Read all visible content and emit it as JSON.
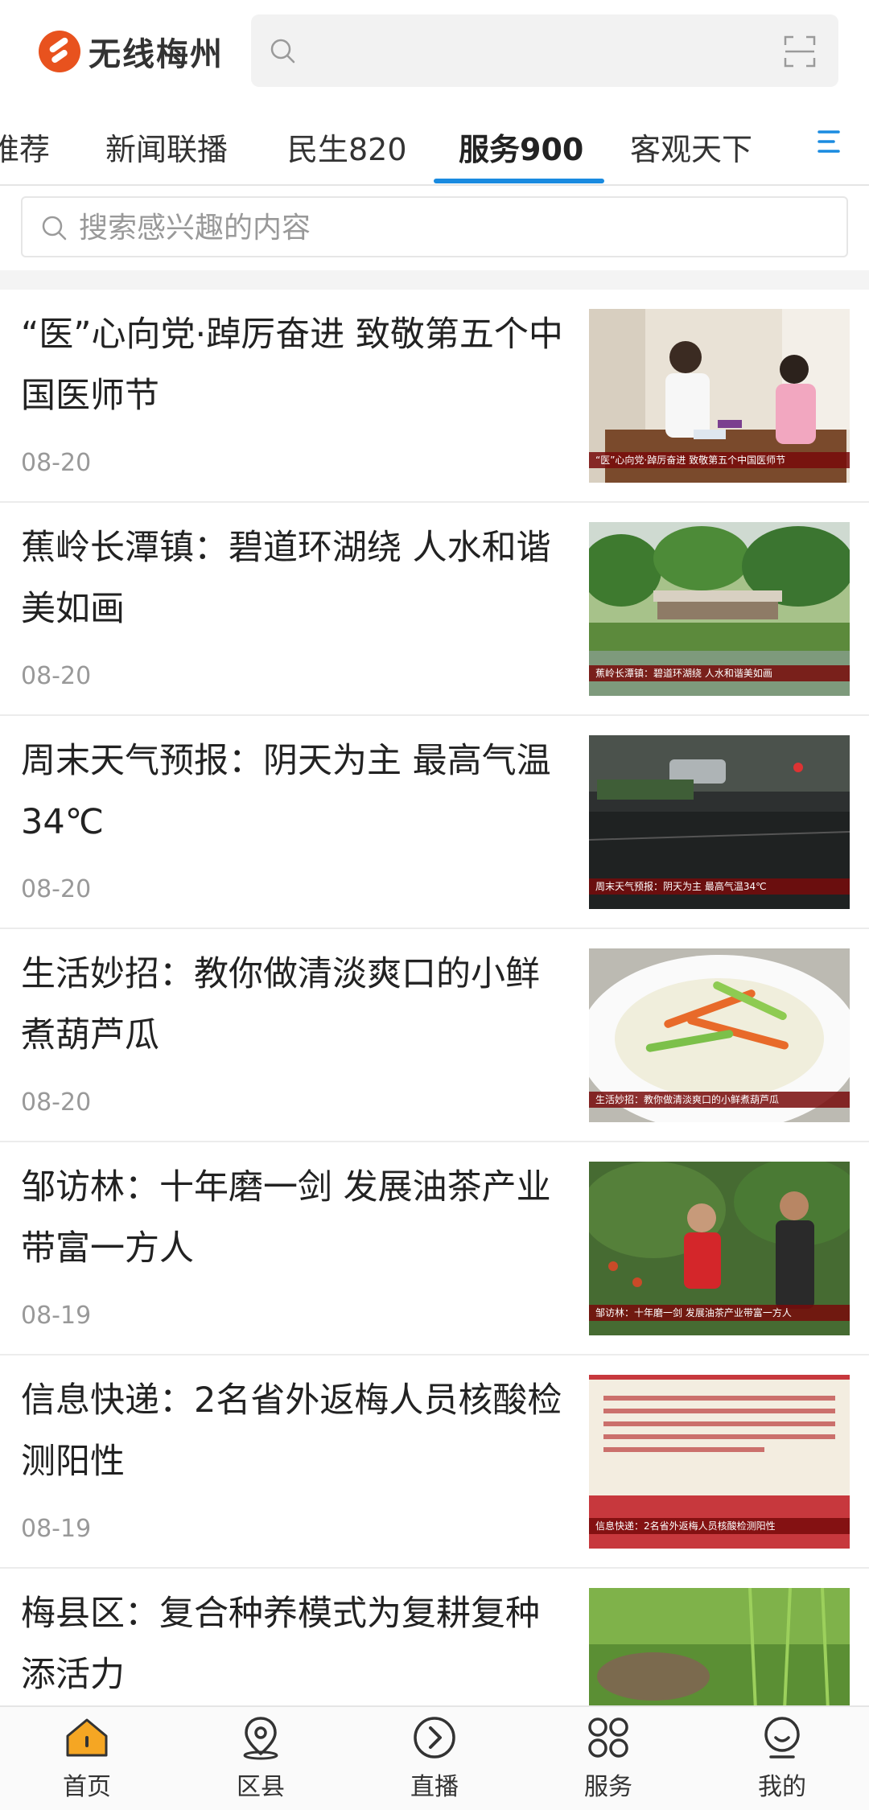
{
  "app": {
    "name": "无线梅州"
  },
  "header": {
    "search_value": ""
  },
  "tabs": [
    {
      "label": "推荐"
    },
    {
      "label": "新闻联播"
    },
    {
      "label": "民生820"
    },
    {
      "label": "服务900",
      "active": true
    },
    {
      "label": "客观天下"
    }
  ],
  "search": {
    "placeholder": "搜索感兴趣的内容"
  },
  "articles": [
    {
      "title": "“医”心向党·踔厉奋进 致敬第五个中国医师节",
      "date": "08-20",
      "caption": "“医”心向党·踔厉奋进 致敬第五个中国医师节"
    },
    {
      "title": "蕉岭长潭镇：碧道环湖绕 人水和谐美如画",
      "date": "08-20",
      "caption": "蕉岭长潭镇：碧道环湖绕 人水和谐美如画"
    },
    {
      "title": "周末天气预报：阴天为主 最高气温34℃",
      "date": "08-20",
      "caption": "周末天气预报：阴天为主 最高气温34℃"
    },
    {
      "title": "生活妙招：教你做清淡爽口的小鲜煮葫芦瓜",
      "date": "08-20",
      "caption": "生活妙招：教你做清淡爽口的小鲜煮葫芦瓜"
    },
    {
      "title": "邹访林：十年磨一剑 发展油茶产业带富一方人",
      "date": "08-19",
      "caption": "邹访林：十年磨一剑 发展油茶产业带富一方人"
    },
    {
      "title": "信息快递：2名省外返梅人员核酸检测阳性",
      "date": "08-19",
      "caption": "信息快递：2名省外返梅人员核酸检测阳性"
    },
    {
      "title": "梅县区：复合种养模式为复耕复种添活力",
      "date": "",
      "caption": ""
    }
  ],
  "bottom_nav": [
    {
      "label": "首页",
      "icon": "home-icon",
      "active": true
    },
    {
      "label": "区县",
      "icon": "location-icon"
    },
    {
      "label": "直播",
      "icon": "play-circle-icon"
    },
    {
      "label": "服务",
      "icon": "grid-icon"
    },
    {
      "label": "我的",
      "icon": "user-icon"
    }
  ],
  "colors": {
    "accent": "#1a8be0",
    "brand": "#e8521e",
    "active_home": "#f5a623"
  }
}
